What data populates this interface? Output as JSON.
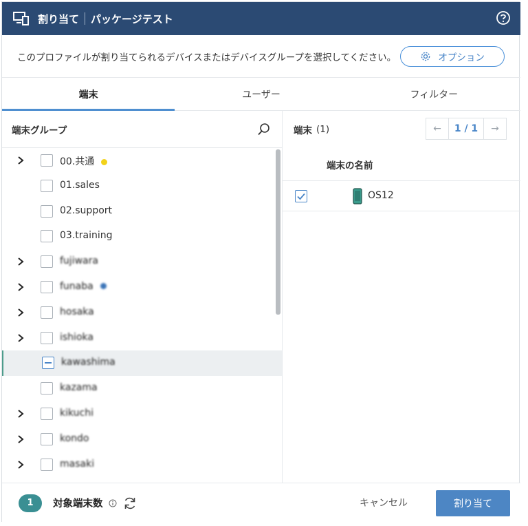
{
  "header": {
    "title": "割り当て",
    "subtitle": "パッケージテスト",
    "help_icon": "help-circle-icon",
    "device_icon": "device-monitor-icon"
  },
  "intro": {
    "text": "このプロファイルが割り当てられるデバイスまたはデバイスグループを選択してください。",
    "option_label": "オプション"
  },
  "tabs": [
    {
      "label": "端末",
      "active": true
    },
    {
      "label": "ユーザー",
      "active": false
    },
    {
      "label": "フィルター",
      "active": false
    }
  ],
  "left": {
    "header": "端末グループ",
    "groups": [
      {
        "label": "00.共通",
        "expandable": true,
        "dot": "#f2d21a"
      },
      {
        "label": "01.sales",
        "expandable": false
      },
      {
        "label": "02.support",
        "expandable": false
      },
      {
        "label": "03.training",
        "expandable": false
      },
      {
        "label": "fujiwara",
        "expandable": true,
        "blurred": true
      },
      {
        "label": "funaba",
        "expandable": true,
        "blurred": true,
        "dot": "#3b74b8"
      },
      {
        "label": "hosaka",
        "expandable": true,
        "blurred": true
      },
      {
        "label": "ishioka",
        "expandable": true,
        "blurred": true
      },
      {
        "label": "kawashima",
        "expandable": false,
        "blurred": true,
        "selected": true,
        "partial": true
      },
      {
        "label": "kazama",
        "expandable": false,
        "blurred": true
      },
      {
        "label": "kikuchi",
        "expandable": true,
        "blurred": true
      },
      {
        "label": "kondo",
        "expandable": true,
        "blurred": true
      },
      {
        "label": "masaki",
        "expandable": true,
        "blurred": true
      }
    ]
  },
  "right": {
    "header": "端末",
    "count": "(1)",
    "pager": {
      "prev": "←",
      "page": "1 / 1",
      "next": "→"
    },
    "column": "端末の名前",
    "devices": [
      {
        "name": "OS12",
        "checked": true
      }
    ]
  },
  "footer": {
    "count": "1",
    "label": "対象端末数",
    "cancel": "キャンセル",
    "assign": "割り当て"
  },
  "colors": {
    "header_bg": "#2b4a73",
    "accent": "#4d86c4",
    "badge": "#3a8f93"
  }
}
